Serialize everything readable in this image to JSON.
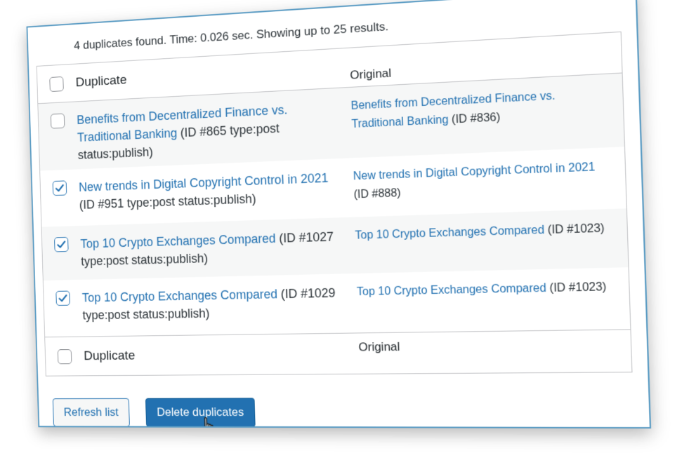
{
  "summary": "4 duplicates found. Time: 0.026 sec. Showing up to 25 results.",
  "table": {
    "col_duplicate": "Duplicate",
    "col_original": "Original",
    "rows": [
      {
        "checked": false,
        "dup_title": "Benefits from Decentralized Finance vs. Traditional Banking",
        "dup_meta": " (ID #865 type:post status:publish)",
        "orig_title": "Benefits from Decentralized Finance vs. Traditional Banking",
        "orig_meta": " (ID #836)"
      },
      {
        "checked": true,
        "dup_title": "New trends in Digital Copyright Control in 2021",
        "dup_meta": " (ID #951 type:post status:publish)",
        "orig_title": "New trends in Digital Copyright Control in 2021",
        "orig_meta": " (ID #888)"
      },
      {
        "checked": true,
        "dup_title": "Top 10 Crypto Exchanges Compared",
        "dup_meta": " (ID #1027 type:post status:publish)",
        "orig_title": "Top 10 Crypto Exchanges Compared",
        "orig_meta": " (ID #1023)"
      },
      {
        "checked": true,
        "dup_title": "Top 10 Crypto Exchanges Compared",
        "dup_meta": " (ID #1029 type:post status:publish)",
        "orig_title": "Top 10 Crypto Exchanges Compared",
        "orig_meta": " (ID #1023)"
      }
    ]
  },
  "buttons": {
    "refresh": "Refresh list",
    "delete": "Delete duplicates"
  },
  "icons": {
    "checkmark": "checkmark-icon",
    "cursor": "hand-pointer-icon"
  },
  "colors": {
    "link": "#2271b1",
    "primary_button": "#2271b1",
    "panel_border": "#5b9cc4"
  }
}
